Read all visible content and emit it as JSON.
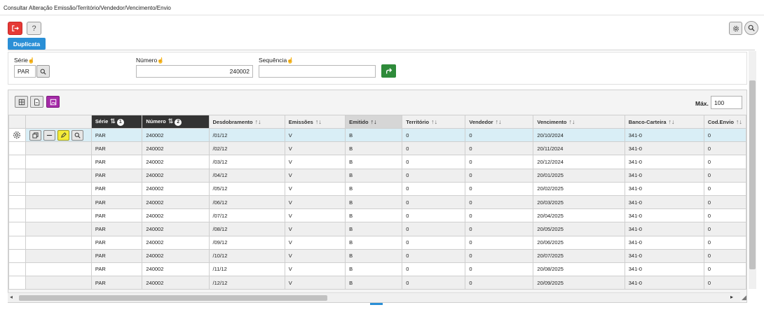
{
  "title": "Consultar Alteração Emissão/Território/Vendedor/Vencimento/Envio",
  "toolbar": {
    "help_label": "?"
  },
  "tab": {
    "label": "Duplicata"
  },
  "filters": {
    "serie": {
      "label": "Série",
      "value": "PAR"
    },
    "numero": {
      "label": "Número",
      "value": "240002"
    },
    "sequencia": {
      "label": "Sequência",
      "value": ""
    }
  },
  "grid": {
    "max_label": "Máx.",
    "max_value": "100",
    "columns": [
      {
        "label": "Série",
        "sort": "⇅",
        "badge": "1"
      },
      {
        "label": "Número",
        "sort": "⇅",
        "badge": "2"
      },
      {
        "label": "Desdobramento",
        "sort": "↑↓"
      },
      {
        "label": "Emissões",
        "sort": "↑↓"
      },
      {
        "label": "Emitido",
        "sort": "↑↓"
      },
      {
        "label": "Território",
        "sort": "↑↓"
      },
      {
        "label": "Vendedor",
        "sort": "↑↓"
      },
      {
        "label": "Vencimento",
        "sort": "↑↓"
      },
      {
        "label": "Banco-Carteira",
        "sort": "↑↓"
      },
      {
        "label": "Cod.Envio",
        "sort": "↑↓"
      }
    ],
    "rows": [
      [
        "PAR",
        "240002",
        "/01/12",
        "V",
        "B",
        "0",
        "0",
        "20/10/2024",
        "341-0",
        "0"
      ],
      [
        "PAR",
        "240002",
        "/02/12",
        "V",
        "B",
        "0",
        "0",
        "20/11/2024",
        "341-0",
        "0"
      ],
      [
        "PAR",
        "240002",
        "/03/12",
        "V",
        "B",
        "0",
        "0",
        "20/12/2024",
        "341-0",
        "0"
      ],
      [
        "PAR",
        "240002",
        "/04/12",
        "V",
        "B",
        "0",
        "0",
        "20/01/2025",
        "341-0",
        "0"
      ],
      [
        "PAR",
        "240002",
        "/05/12",
        "V",
        "B",
        "0",
        "0",
        "20/02/2025",
        "341-0",
        "0"
      ],
      [
        "PAR",
        "240002",
        "/06/12",
        "V",
        "B",
        "0",
        "0",
        "20/03/2025",
        "341-0",
        "0"
      ],
      [
        "PAR",
        "240002",
        "/07/12",
        "V",
        "B",
        "0",
        "0",
        "20/04/2025",
        "341-0",
        "0"
      ],
      [
        "PAR",
        "240002",
        "/08/12",
        "V",
        "B",
        "0",
        "0",
        "20/05/2025",
        "341-0",
        "0"
      ],
      [
        "PAR",
        "240002",
        "/09/12",
        "V",
        "B",
        "0",
        "0",
        "20/06/2025",
        "341-0",
        "0"
      ],
      [
        "PAR",
        "240002",
        "/10/12",
        "V",
        "B",
        "0",
        "0",
        "20/07/2025",
        "341-0",
        "0"
      ],
      [
        "PAR",
        "240002",
        "/11/12",
        "V",
        "B",
        "0",
        "0",
        "20/08/2025",
        "341-0",
        "0"
      ],
      [
        "PAR",
        "240002",
        "/12/12",
        "V",
        "B",
        "0",
        "0",
        "20/09/2025",
        "341-0",
        "0"
      ]
    ]
  },
  "colors": {
    "accent_blue": "#2a8fd6",
    "exit_red": "#e53935",
    "go_green": "#2e8b3a",
    "selected_row": "#d9eef6",
    "header_dark": "#333333",
    "purple_tool": "#a52aa8",
    "edit_yellow": "#f4eb3a"
  },
  "icons": [
    "exit-icon",
    "help-icon",
    "settings-icon",
    "search-icon",
    "arrow-right-icon",
    "grid-icon",
    "document-icon",
    "image-icon",
    "gear-icon",
    "copy-icon",
    "minus-icon",
    "pencil-icon",
    "hand-pointer-icon"
  ]
}
